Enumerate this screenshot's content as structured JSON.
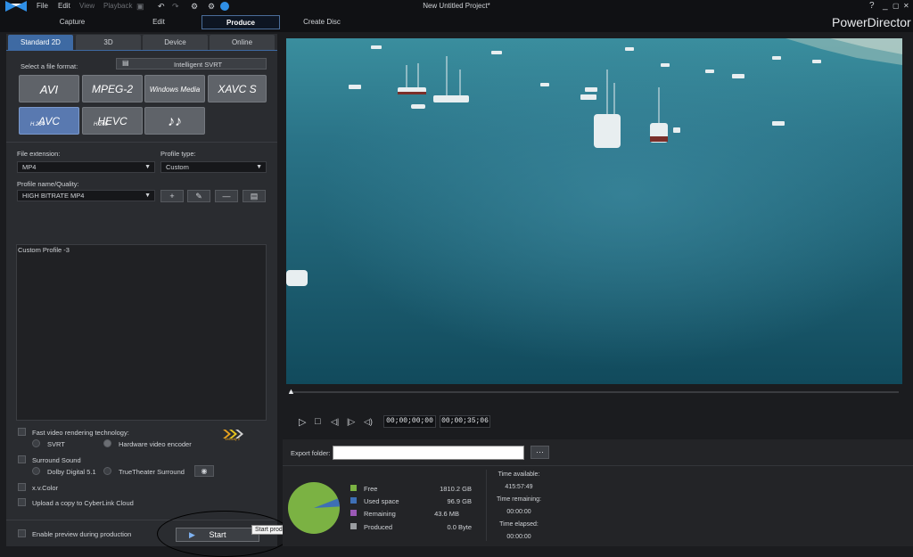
{
  "menubar": {
    "file": "File",
    "edit": "Edit",
    "view": "View",
    "playback": "Playback"
  },
  "project_title": "New Untitled Project*",
  "brand": "PowerDirector",
  "window_controls": {
    "help": "?",
    "minimize": "_",
    "maximize": "▢",
    "close": "✕"
  },
  "modes": [
    {
      "label": "Capture"
    },
    {
      "label": "Edit"
    },
    {
      "label": "Produce",
      "active": true
    },
    {
      "label": "Create Disc"
    }
  ],
  "left_tabs": [
    {
      "label": "Standard 2D",
      "active": true
    },
    {
      "label": "3D"
    },
    {
      "label": "Device"
    },
    {
      "label": "Online"
    }
  ],
  "format": {
    "select_label": "Select a file format:",
    "intelligent_svrt": "Intelligent SVRT",
    "buttons": [
      {
        "label": "AVI"
      },
      {
        "label": "MPEG-2"
      },
      {
        "label": "Windows Media"
      },
      {
        "label": "XAVC S"
      },
      {
        "label": "AVC",
        "sup": "H.264",
        "selected": true
      },
      {
        "label": "HEVC",
        "sup": "H.265"
      },
      {
        "label": "♪♪"
      }
    ]
  },
  "file_extension": {
    "label": "File extension:",
    "value": "MP4"
  },
  "profile_type": {
    "label": "Profile type:",
    "value": "Custom"
  },
  "profile_name": {
    "label": "Profile name/Quality:",
    "value": "HIGH BITRATE MP4"
  },
  "profile_buttons": [
    "+",
    "✎",
    "—",
    "▤"
  ],
  "custom_profile_text": "Custom Profile -3",
  "options": {
    "fast_rendering": "Fast video rendering technology:",
    "svrt": "SVRT",
    "hw_encoder": "Hardware video encoder",
    "velocity_label": "Velocity 2",
    "surround": "Surround Sound",
    "dolby": "Dolby Digital 5.1",
    "truetheater": "TrueTheater Surround",
    "xvcolor": "x.v.Color",
    "upload": "Upload a copy to CyberLink Cloud",
    "preview": "Enable preview during production"
  },
  "start_button": "Start",
  "tooltip": "Start producing your video",
  "player": {
    "controls": [
      "▷",
      "□",
      "◁|",
      "|▷",
      "◁)"
    ],
    "timecode_current": "00;00;00;00",
    "timecode_total": "00;00;35;06"
  },
  "export": {
    "label": "Export folder:",
    "value": "",
    "browse": "···"
  },
  "disk": {
    "legend": [
      {
        "label": "Free",
        "value": "1810.2 GB",
        "color": "#7bb243"
      },
      {
        "label": "Used space",
        "value": "96.9 GB",
        "color": "#3e6fb5"
      },
      {
        "label": "Remaining",
        "value": "43.6 MB",
        "color": "#9b59b6"
      },
      {
        "label": "Produced",
        "value": "0.0 Byte",
        "color": "#9a9da1"
      }
    ]
  },
  "times": {
    "available_label": "Time available:",
    "available": "415:57:49",
    "remaining_label": "Time remaining:",
    "remaining": "00:00:00",
    "elapsed_label": "Time elapsed:",
    "elapsed": "00:00:00"
  }
}
